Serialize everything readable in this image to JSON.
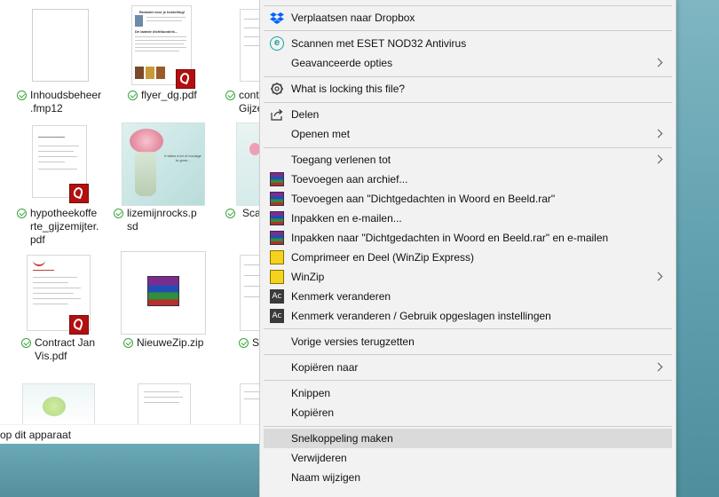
{
  "explorer": {
    "files": [
      {
        "id": "inhoudsbeheer",
        "lines": [
          "Inhoudsbeheer",
          ".fmp12"
        ]
      },
      {
        "id": "flyer",
        "lines": [
          "flyer_dg.pdf"
        ]
      },
      {
        "id": "cont1",
        "lines": [
          "cont",
          "Gijze"
        ]
      },
      {
        "id": "hypotheek",
        "lines": [
          "hypotheekoffe",
          "rte_gijzemijter.",
          "pdf"
        ]
      },
      {
        "id": "lizemijn",
        "lines": [
          "lizemijnrocks.p",
          "sd"
        ]
      },
      {
        "id": "scan",
        "lines": [
          "Sca"
        ]
      },
      {
        "id": "contract",
        "lines": [
          "Contract Jan",
          "Vis.pdf"
        ]
      },
      {
        "id": "nieuwezip",
        "lines": [
          "NieuweZip.zip"
        ]
      },
      {
        "id": "s",
        "lines": [
          "S"
        ]
      }
    ],
    "status_text": "op dit apparaat"
  },
  "menu": {
    "items": [
      {
        "label": "Verplaatsen naar Dropbox",
        "icon": "dropbox-icon"
      },
      {
        "label": "Scannen met ESET NOD32 Antivirus",
        "icon": "eset-icon"
      },
      {
        "label": "Geavanceerde opties"
      },
      {
        "label": "What is locking this file?",
        "icon": "lock-search-icon"
      },
      {
        "label": "Delen",
        "icon": "share-icon"
      },
      {
        "label": "Openen met"
      },
      {
        "label": "Toegang verlenen tot"
      },
      {
        "label": "Toevoegen aan archief...",
        "icon": "winrar-icon"
      },
      {
        "label": "Toevoegen aan \"Dichtgedachten in Woord en Beeld.rar\"",
        "icon": "winrar-icon"
      },
      {
        "label": "Inpakken en e-mailen...",
        "icon": "winrar-icon"
      },
      {
        "label": "Inpakken naar \"Dichtgedachten in Woord en Beeld.rar\" en e-mailen",
        "icon": "winrar-icon"
      },
      {
        "label": "Comprimeer en Deel (WinZip Express)",
        "icon": "winzip-icon"
      },
      {
        "label": "WinZip",
        "icon": "winzip-icon"
      },
      {
        "label": "Kenmerk veranderen",
        "icon": "attribute-icon"
      },
      {
        "label": "Kenmerk veranderen / Gebruik opgeslagen instellingen",
        "icon": "attribute-icon"
      },
      {
        "label": "Vorige versies terugzetten"
      },
      {
        "label": "Kopiëren naar"
      },
      {
        "label": "Knippen"
      },
      {
        "label": "Kopiëren"
      },
      {
        "label": "Snelkoppeling maken"
      },
      {
        "label": "Verwijderen"
      },
      {
        "label": "Naam wijzigen"
      }
    ],
    "ac_glyph": "Ac",
    "eset_glyph": "e"
  },
  "flyer_preview": {
    "title": "Bedankt voor je bestelling!",
    "subtitle": "De laatste dichtbundels..."
  },
  "lizemijn_preview": {
    "text": "It takes a lot of courage to grow..."
  }
}
